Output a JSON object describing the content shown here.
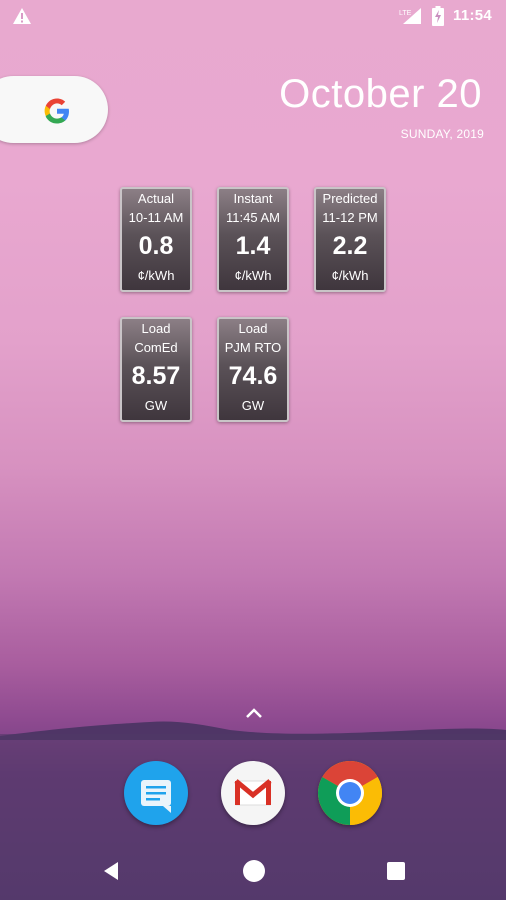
{
  "statusbar": {
    "time": "11:54",
    "icons": [
      "warning-icon",
      "lte-signal-icon",
      "battery-charging-icon"
    ]
  },
  "google_widget": {
    "icon": "google-g-icon"
  },
  "clock_widget": {
    "date": "October 20",
    "weekday_year": "SUNDAY, 2019"
  },
  "tiles": [
    {
      "line1": "Actual",
      "line2": "10-11 AM",
      "value": "0.8",
      "unit": "¢/kWh"
    },
    {
      "line1": "Instant",
      "line2": "11:45 AM",
      "value": "1.4",
      "unit": "¢/kWh"
    },
    {
      "line1": "Predicted",
      "line2": "11-12 PM",
      "value": "2.2",
      "unit": "¢/kWh"
    },
    {
      "line1": "Load",
      "line2": "ComEd",
      "value": "8.57",
      "unit": "GW"
    },
    {
      "line1": "Load",
      "line2": "PJM RTO",
      "value": "74.6",
      "unit": "GW"
    }
  ],
  "dock": {
    "apps": [
      "messages-icon",
      "gmail-icon",
      "chrome-icon"
    ]
  },
  "navbar": {
    "buttons": [
      "back-icon",
      "home-icon",
      "recents-icon"
    ]
  }
}
